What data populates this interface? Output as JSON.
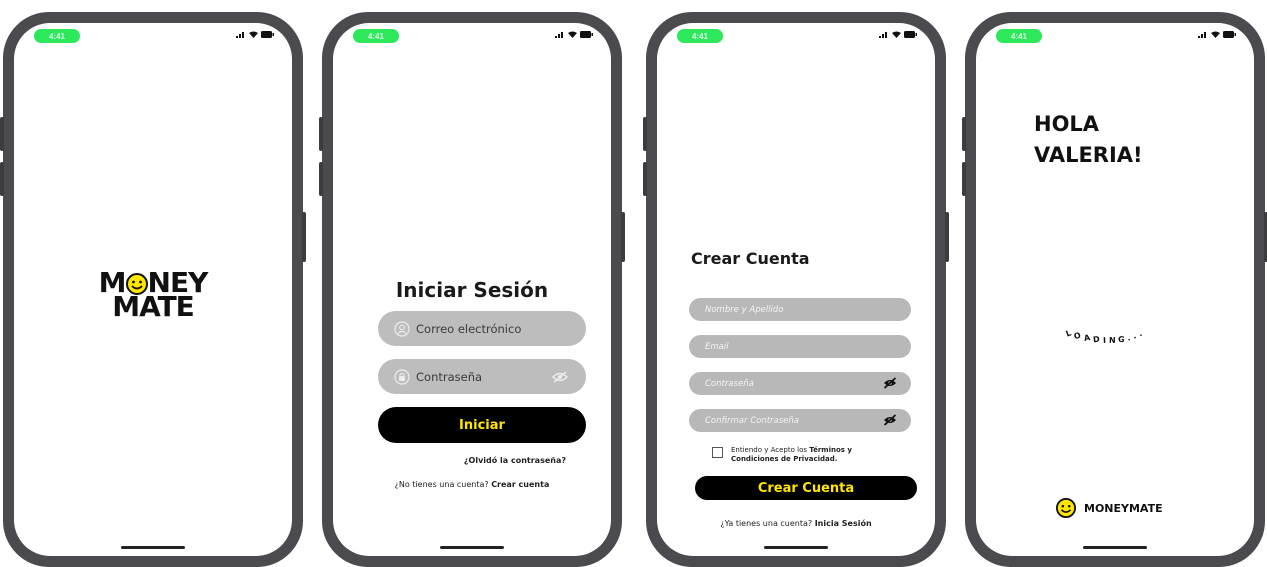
{
  "status": {
    "time": "4:41"
  },
  "splash": {
    "logo_line1_a": "M",
    "logo_line1_b": "NEY",
    "logo_line2": "MATE"
  },
  "login": {
    "title": "Iniciar Sesión",
    "email_placeholder": "Correo electrónico",
    "password_placeholder": "Contraseña",
    "submit_label": "Iniciar",
    "forgot_label": "¿Olvidó la contraseña?",
    "no_account_text": "¿No tienes una cuenta?",
    "create_link": "Crear cuenta"
  },
  "register": {
    "title": "Crear Cuenta",
    "name_placeholder": "Nombre y Apellido",
    "email_placeholder": "Email",
    "password_placeholder": "Contraseña",
    "confirm_placeholder": "Confirmar Contraseña",
    "terms_prefix": "Entiendo y Acepto los",
    "terms_bold_1": "Términos y",
    "terms_bold_2": "Condiciones de Privacidad.",
    "terms_checked": false,
    "submit_label": "Crear Cuenta",
    "have_account_text": "¿Ya tienes una cuenta?",
    "login_link": "Inicia Sesión"
  },
  "home": {
    "greeting_line1": "HOLA",
    "greeting_line2": "VALERIA!",
    "loading_text": "LOADING...",
    "brand": "MONEYMATE"
  },
  "colors": {
    "accent_yellow": "#ffe600",
    "input_gray": "#bdbdbd",
    "status_green": "#2ee85c",
    "frame": "#4a4a4f"
  }
}
